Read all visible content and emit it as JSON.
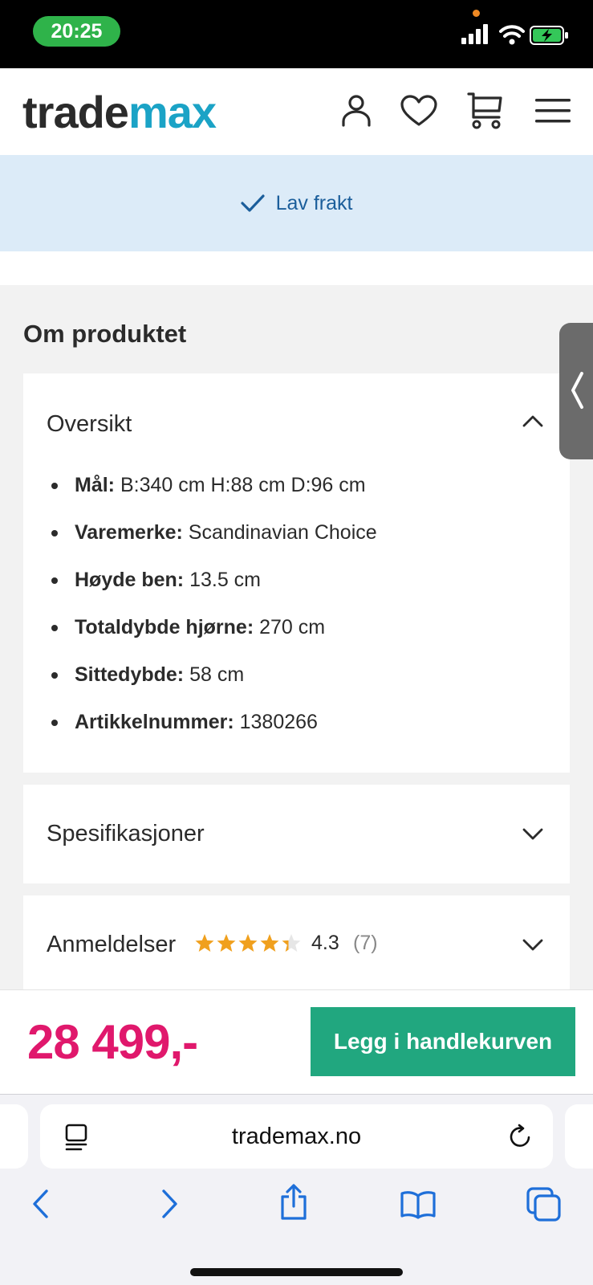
{
  "status_bar": {
    "time": "20:25"
  },
  "header": {
    "logo_part1": "trade",
    "logo_part2": "max",
    "icons": [
      "user-icon",
      "heart-icon",
      "cart-icon",
      "menu-icon"
    ]
  },
  "banner": {
    "text": "Lav frakt"
  },
  "product_info": {
    "title": "Om produktet",
    "overview": {
      "title": "Oversikt",
      "items": [
        {
          "label": "Mål:",
          "value": " B:340 cm H:88 cm D:96 cm"
        },
        {
          "label": "Varemerke:",
          "value": " Scandinavian Choice"
        },
        {
          "label": "Høyde ben:",
          "value": " 13.5 cm"
        },
        {
          "label": "Totaldybde hjørne:",
          "value": " 270 cm"
        },
        {
          "label": "Sittedybde:",
          "value": " 58 cm"
        },
        {
          "label": "Artikkelnummer:",
          "value": " 1380266"
        }
      ]
    },
    "specs": {
      "title": "Spesifikasjoner"
    },
    "reviews": {
      "title": "Anmeldelser",
      "rating": "4.3",
      "rating_value": 4.3,
      "count": "(7)"
    }
  },
  "purchase": {
    "price": "28 499,-",
    "button_label": "Legg i handlekurven"
  },
  "browser": {
    "url": "trademax.no"
  },
  "colors": {
    "price": "#e0186c",
    "button": "#21a77f",
    "logo_accent": "#1ba3c6",
    "star": "#f0a01e"
  }
}
